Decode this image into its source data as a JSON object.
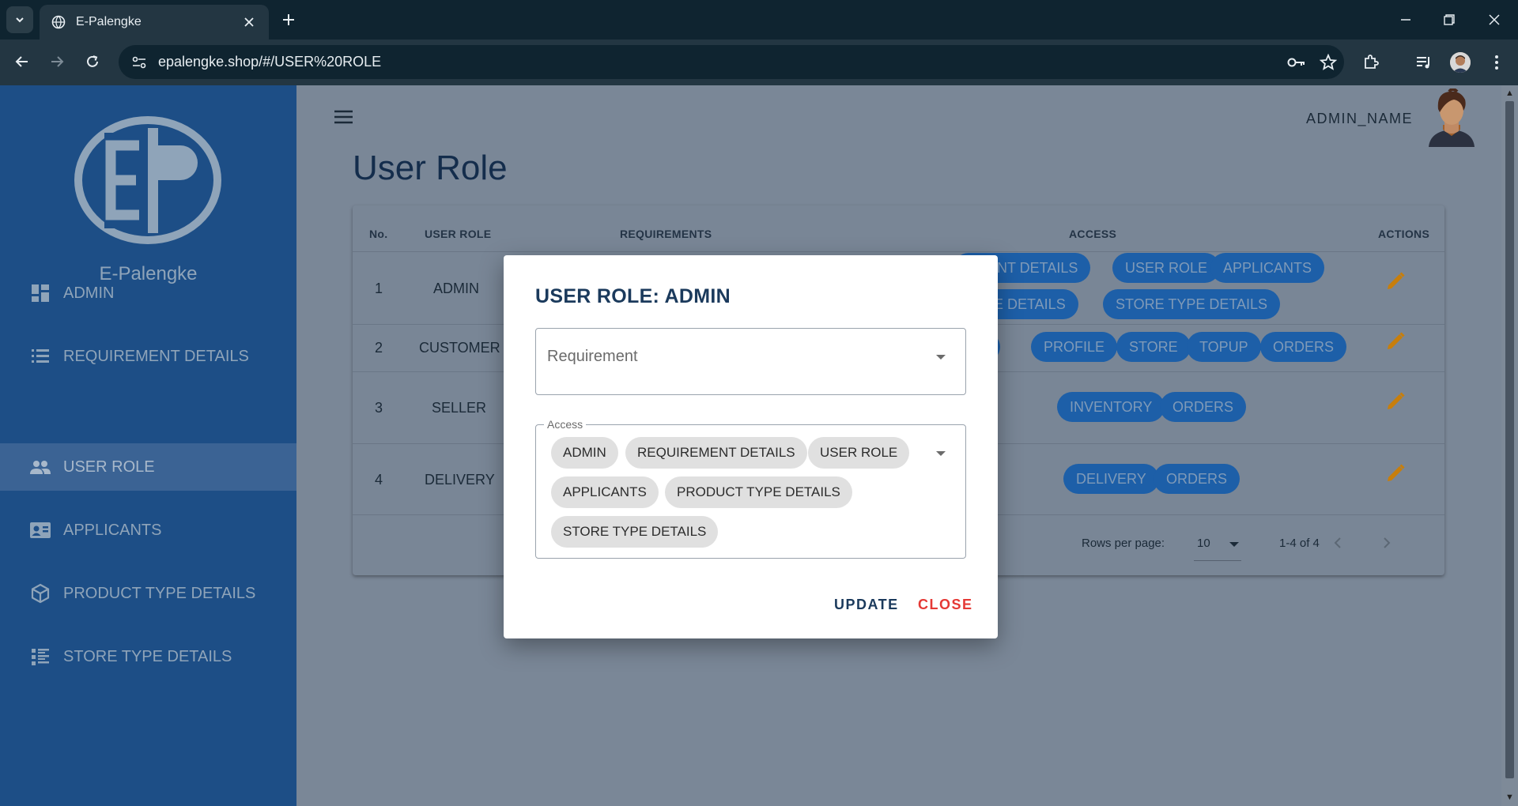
{
  "browser": {
    "tab_title": "E-Palengke",
    "url": "epalengke.shop/#/USER%20ROLE"
  },
  "sidebar": {
    "app_name": "E-Palengke",
    "items": [
      {
        "label": "ADMIN",
        "icon": "dashboard-icon"
      },
      {
        "label": "REQUIREMENT DETAILS",
        "icon": "list-icon"
      },
      {
        "label": "USER ROLE",
        "icon": "people-icon",
        "active": true
      },
      {
        "label": "APPLICANTS",
        "icon": "id-card-icon"
      },
      {
        "label": "PRODUCT TYPE DETAILS",
        "icon": "cube-icon"
      },
      {
        "label": "STORE TYPE DETAILS",
        "icon": "list-detail-icon"
      }
    ]
  },
  "header": {
    "admin_name": "ADMIN_NAME",
    "page_title": "User Role"
  },
  "table": {
    "headers": {
      "no": "No.",
      "role": "USER ROLE",
      "requirements": "REQUIREMENTS",
      "access": "ACCESS",
      "actions": "ACTIONS"
    },
    "rows": [
      {
        "no": "1",
        "role": "ADMIN",
        "access_visible": [
          "EMENT DETAILS",
          "USER ROLE",
          "APPLICANTS",
          "TYPE DETAILS",
          "STORE TYPE DETAILS"
        ]
      },
      {
        "no": "2",
        "role": "CUSTOMER",
        "access_visible": [
          "ON",
          "PROFILE",
          "STORE",
          "TOPUP",
          "ORDERS"
        ]
      },
      {
        "no": "3",
        "role": "SELLER",
        "access_visible": [
          "INVENTORY",
          "ORDERS"
        ]
      },
      {
        "no": "4",
        "role": "DELIVERY",
        "access_visible": [
          "DELIVERY",
          "ORDERS"
        ]
      }
    ],
    "pagination": {
      "rows_per_page_label": "Rows per page:",
      "rows_per_page": "10",
      "range": "1-4 of 4"
    }
  },
  "dialog": {
    "title": "USER ROLE: ADMIN",
    "requirement_placeholder": "Requirement",
    "access_label": "Access",
    "access_chips": [
      "ADMIN",
      "REQUIREMENT DETAILS",
      "USER ROLE",
      "APPLICANTS",
      "PRODUCT TYPE DETAILS",
      "STORE TYPE DETAILS"
    ],
    "update_label": "UPDATE",
    "close_label": "CLOSE"
  },
  "colors": {
    "sidebar_bg": "#1d4e86",
    "chip_blue": "#1d5fa8",
    "edit_orange": "#c77e0c",
    "dialog_title": "#1b3a5c",
    "close_red": "#e53935",
    "update_blue": "#1b3a5c"
  }
}
